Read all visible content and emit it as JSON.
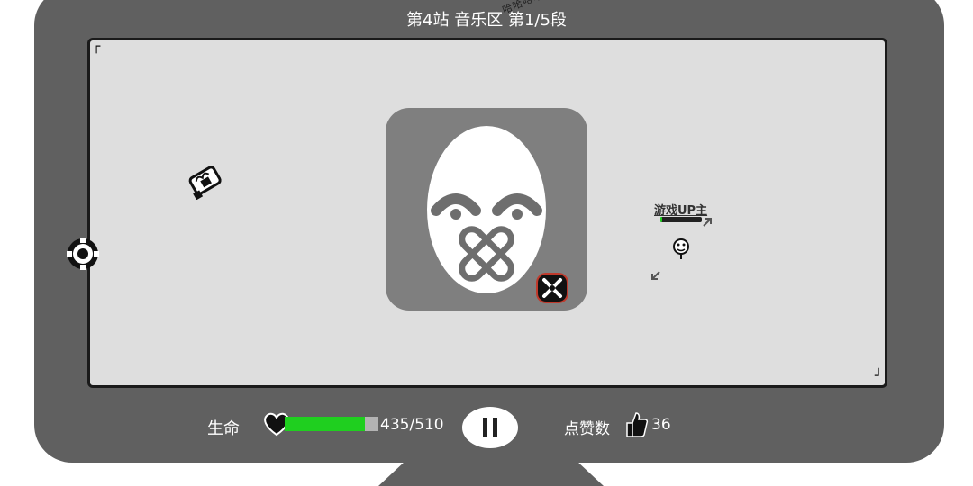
{
  "hud": {
    "stage_title": "第4站 音乐区  第1/5段",
    "scribble_text": "哈哈哈哈哈",
    "life_label": "生命",
    "hp_current": 435,
    "hp_max": 510,
    "hp_text": "435/510",
    "likes_label": "点赞数",
    "likes_count": "36"
  },
  "enemy": {
    "label": "游戏UP主",
    "hp_fraction": 0.05
  },
  "colors": {
    "frame": "#606060",
    "screen": "#dedede",
    "hp_fill": "#1fcf1f",
    "boss_card": "#7f7f7f"
  },
  "icons": {
    "heart": "heart-icon",
    "thumb": "thumbs-up-icon",
    "pause": "pause-icon",
    "joystick": "joystick-icon",
    "skill": "skill-x-icon"
  }
}
